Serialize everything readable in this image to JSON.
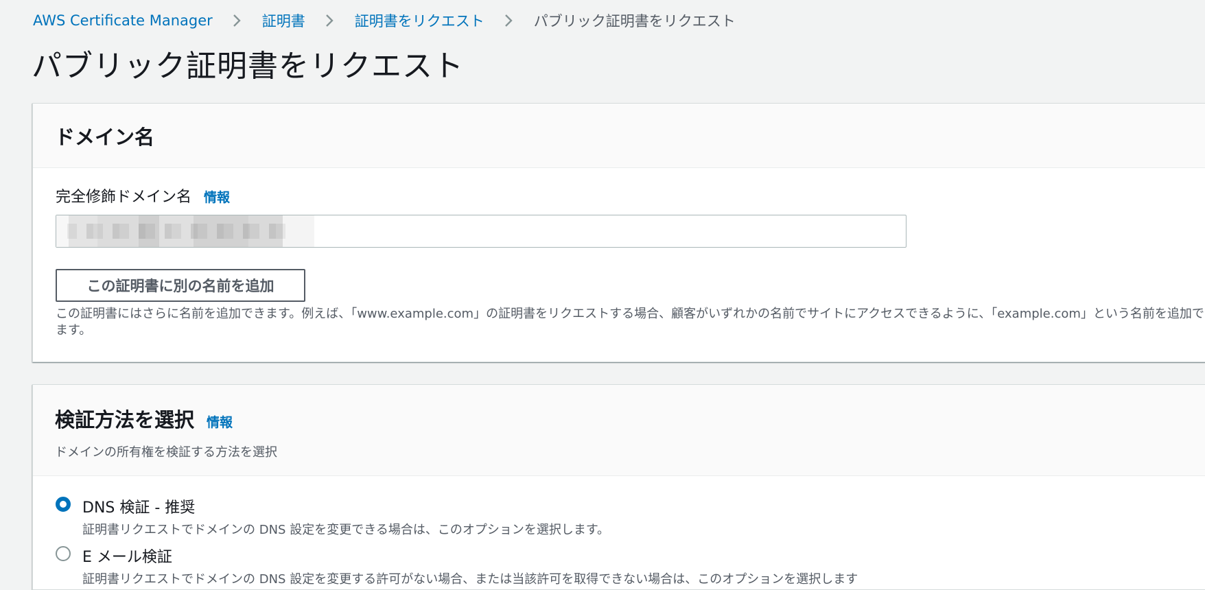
{
  "breadcrumb": {
    "items": [
      "AWS Certificate Manager",
      "証明書",
      "証明書をリクエスト"
    ],
    "current": "パブリック証明書をリクエスト"
  },
  "page": {
    "title": "パブリック証明書をリクエスト"
  },
  "domain_panel": {
    "title": "ドメイン名",
    "field_label": "完全修飾ドメイン名",
    "info": "情報",
    "input_value": "",
    "add_button": "この証明書に別の名前を追加",
    "helper": "この証明書にはさらに名前を追加できます。例えば、「www.example.com」の証明書をリクエストする場合、顧客がいずれかの名前でサイトにアクセスできるように、「example.com」という名前を追加できます。"
  },
  "method_panel": {
    "title": "検証方法を選択",
    "info": "情報",
    "description": "ドメインの所有権を検証する方法を選択",
    "options": [
      {
        "label": "DNS 検証 - 推奨",
        "description": "証明書リクエストでドメインの DNS 設定を変更できる場合は、このオプションを選択します。",
        "selected": true
      },
      {
        "label": "E メール検証",
        "description": "証明書リクエストでドメインの DNS 設定を変更する許可がない場合、または当該許可を取得できない場合は、このオプションを選択します",
        "selected": false
      }
    ]
  },
  "colors": {
    "link": "#0073bb",
    "background": "#f2f3f3",
    "radio_selected": "#0073bb"
  }
}
